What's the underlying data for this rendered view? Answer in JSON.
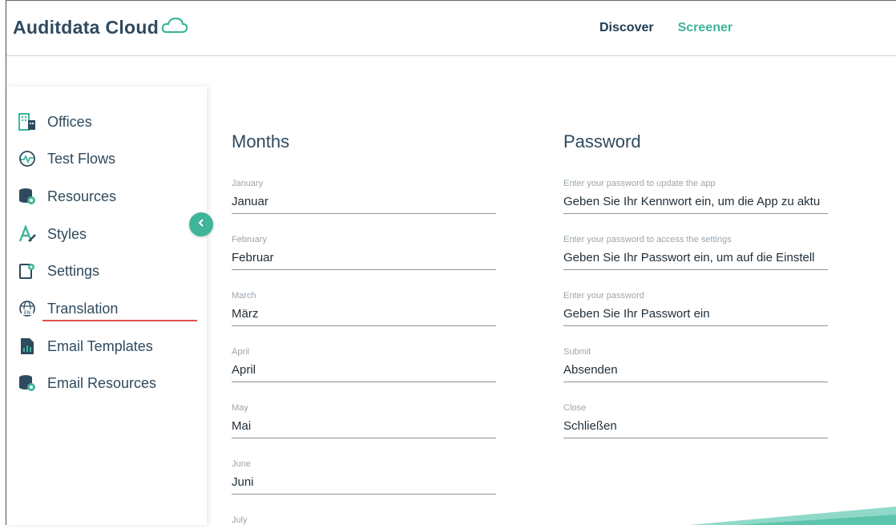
{
  "header": {
    "logo_text": "Auditdata Cloud",
    "nav": [
      {
        "label": "Discover",
        "active": false
      },
      {
        "label": "Screener",
        "active": true
      }
    ]
  },
  "sidebar": {
    "items": [
      {
        "label": "Offices",
        "icon": "building-icon"
      },
      {
        "label": "Test Flows",
        "icon": "flow-icon"
      },
      {
        "label": "Resources",
        "icon": "database-icon"
      },
      {
        "label": "Styles",
        "icon": "brush-icon"
      },
      {
        "label": "Settings",
        "icon": "device-settings-icon"
      },
      {
        "label": "Translation",
        "icon": "globe-en-icon",
        "active": true
      },
      {
        "label": "Email Templates",
        "icon": "chart-doc-icon"
      },
      {
        "label": "Email Resources",
        "icon": "database-icon"
      }
    ]
  },
  "months": {
    "title": "Months",
    "fields": [
      {
        "label": "January",
        "value": "Januar"
      },
      {
        "label": "February",
        "value": "Februar"
      },
      {
        "label": "March",
        "value": "März"
      },
      {
        "label": "April",
        "value": "April"
      },
      {
        "label": "May",
        "value": "Mai"
      },
      {
        "label": "June",
        "value": "Juni"
      },
      {
        "label": "July",
        "value": ""
      }
    ]
  },
  "password": {
    "title": "Password",
    "fields": [
      {
        "label": "Enter your password to update the app",
        "value": "Geben Sie Ihr Kennwort ein, um die App zu aktu"
      },
      {
        "label": "Enter your password to access the settings",
        "value": "Geben Sie Ihr Passwort ein, um auf die Einstell"
      },
      {
        "label": "Enter your password",
        "value": "Geben Sie Ihr Passwort ein"
      },
      {
        "label": "Submit",
        "value": "Absenden"
      },
      {
        "label": "Close",
        "value": "Schließen"
      }
    ]
  },
  "colors": {
    "accent": "#3fb59b",
    "active_underline": "#e05252",
    "text": "#2e4a5e"
  }
}
